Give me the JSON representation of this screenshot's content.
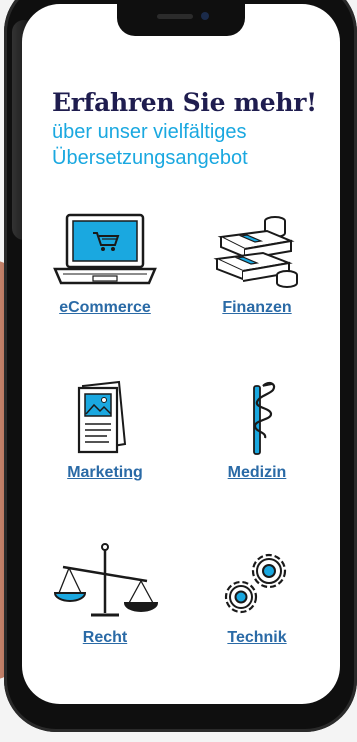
{
  "heading": {
    "title": "Erfahren Sie mehr!",
    "subtitle_line1": "über unser vielfältiges",
    "subtitle_line2": "Übersetzungsangebot"
  },
  "categories": [
    {
      "label": "eCommerce",
      "icon": "laptop-cart-icon"
    },
    {
      "label": "Finanzen",
      "icon": "money-stacks-icon"
    },
    {
      "label": "Marketing",
      "icon": "brochure-icon"
    },
    {
      "label": "Medizin",
      "icon": "caduceus-icon"
    },
    {
      "label": "Recht",
      "icon": "scales-icon"
    },
    {
      "label": "Technik",
      "icon": "gears-icon"
    }
  ],
  "colors": {
    "title": "#1f1d4f",
    "subtitle": "#1aa8e0",
    "link": "#2a6aa6",
    "accent": "#1aa8e0",
    "ink": "#1a1a1a"
  }
}
